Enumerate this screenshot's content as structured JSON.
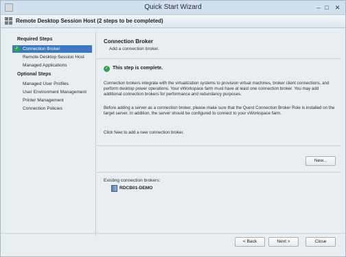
{
  "window": {
    "title": "Quick Start Wizard"
  },
  "header": {
    "title": "Remote Desktop Session Host  (2 steps to be completed)"
  },
  "sidebar": {
    "required_heading": "Required Steps",
    "required_items": [
      {
        "label": "Connection Broker",
        "active": true
      },
      {
        "label": "Remote Desktop Session Host"
      },
      {
        "label": "Managed Applications"
      }
    ],
    "optional_heading": "Optional Steps",
    "optional_items": [
      {
        "label": "Managed User Profiles"
      },
      {
        "label": "User Environment Management"
      },
      {
        "label": "Printer Management"
      },
      {
        "label": "Connection Policies"
      }
    ]
  },
  "content": {
    "title": "Connection Broker",
    "subtitle": "Add a connection broker.",
    "status": "This step is complete.",
    "paragraphs": [
      "Connection brokers integrate with the virtualization systems to provision virtual machines, broker client connections, and perform desktop power operations.  Your vWorkspace farm must have at least one connection broker.  You may add additional connection brokers for performance and redundancy purposes.",
      "Before adding a server as a connection broker, please make sure that the Quest Connection Broker Role is installed on the target server.  In addition, the server should be configured to connect to your vWorkspace farm.",
      "Click New to add a new connection broker."
    ],
    "new_button": "New...",
    "existing_label": "Existing connection brokers:",
    "brokers": [
      "RDCB01-DEMO"
    ]
  },
  "footer": {
    "back": "< Back",
    "next": "Next >",
    "close": "Close"
  },
  "colors": {
    "accent": "#3b78bf",
    "check": "#32a24a"
  }
}
